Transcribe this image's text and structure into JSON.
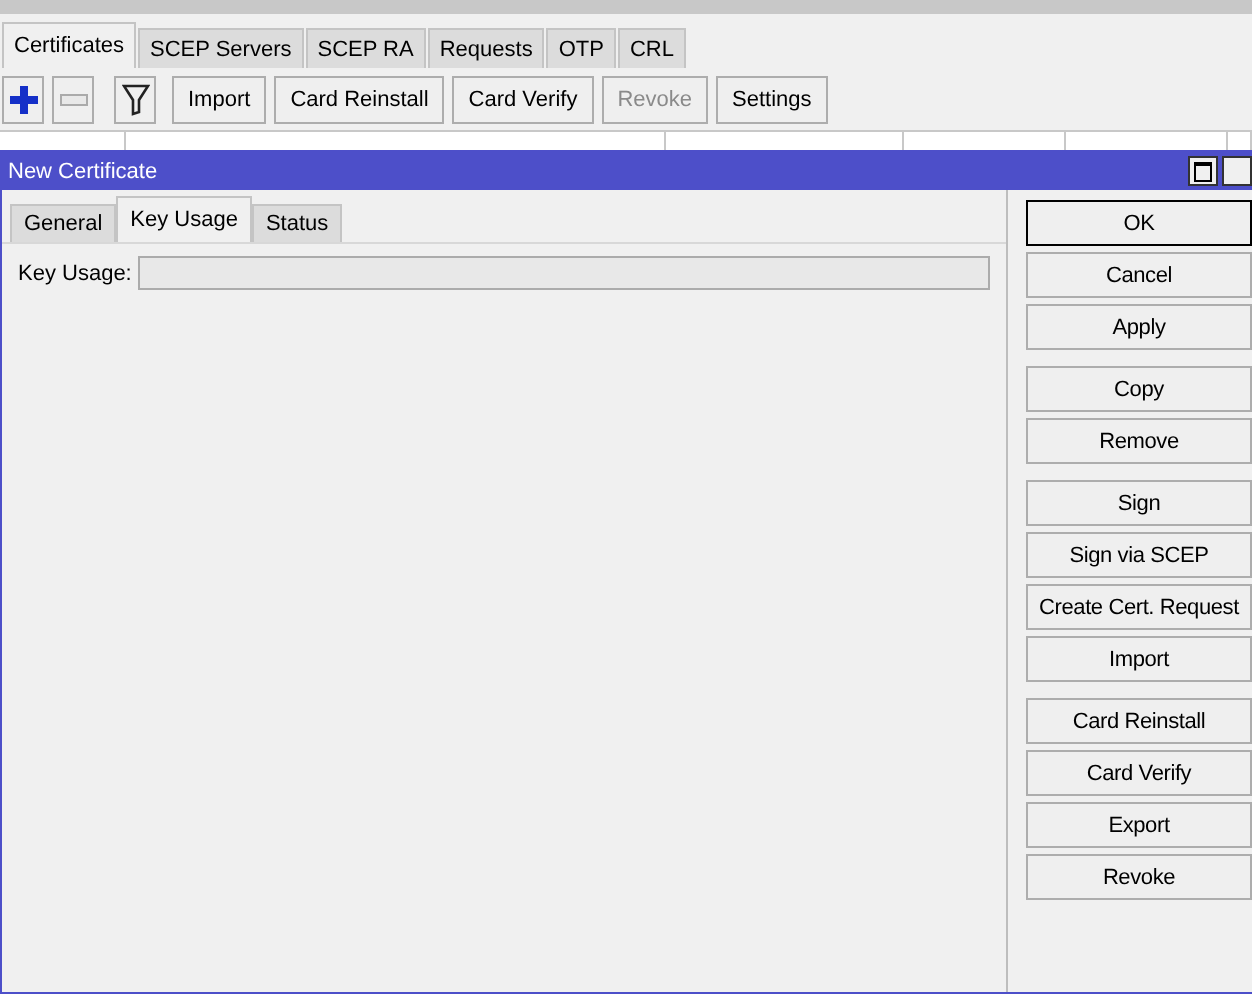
{
  "tabs": [
    {
      "label": "Certificates",
      "selected": true
    },
    {
      "label": "SCEP Servers",
      "selected": false
    },
    {
      "label": "SCEP RA",
      "selected": false
    },
    {
      "label": "Requests",
      "selected": false
    },
    {
      "label": "OTP",
      "selected": false
    },
    {
      "label": "CRL",
      "selected": false
    }
  ],
  "toolbar": [
    {
      "kind": "add"
    },
    {
      "kind": "remove"
    },
    {
      "kind": "filter"
    },
    {
      "kind": "text",
      "label": "Import",
      "disabled": false
    },
    {
      "kind": "text",
      "label": "Card Reinstall",
      "disabled": false
    },
    {
      "kind": "text",
      "label": "Card Verify",
      "disabled": false
    },
    {
      "kind": "text",
      "label": "Revoke",
      "disabled": true
    },
    {
      "kind": "text",
      "label": "Settings",
      "disabled": false
    }
  ],
  "dialog": {
    "title": "New Certificate",
    "tabs": [
      {
        "label": "General",
        "selected": false
      },
      {
        "label": "Key Usage",
        "selected": true
      },
      {
        "label": "Status",
        "selected": false
      }
    ],
    "fields": [
      {
        "label": "Key Usage:"
      }
    ],
    "button_groups": [
      [
        {
          "label": "OK",
          "default": true
        },
        {
          "label": "Cancel",
          "default": false
        },
        {
          "label": "Apply",
          "default": false
        }
      ],
      [
        {
          "label": "Copy",
          "default": false
        },
        {
          "label": "Remove",
          "default": false
        }
      ],
      [
        {
          "label": "Sign",
          "default": false
        },
        {
          "label": "Sign via SCEP",
          "default": false
        },
        {
          "label": "Create Cert. Request",
          "default": false
        },
        {
          "label": "Import",
          "default": false
        }
      ],
      [
        {
          "label": "Card Reinstall",
          "default": false
        },
        {
          "label": "Card Verify",
          "default": false
        },
        {
          "label": "Export",
          "default": false
        },
        {
          "label": "Revoke",
          "default": false
        }
      ]
    ]
  }
}
